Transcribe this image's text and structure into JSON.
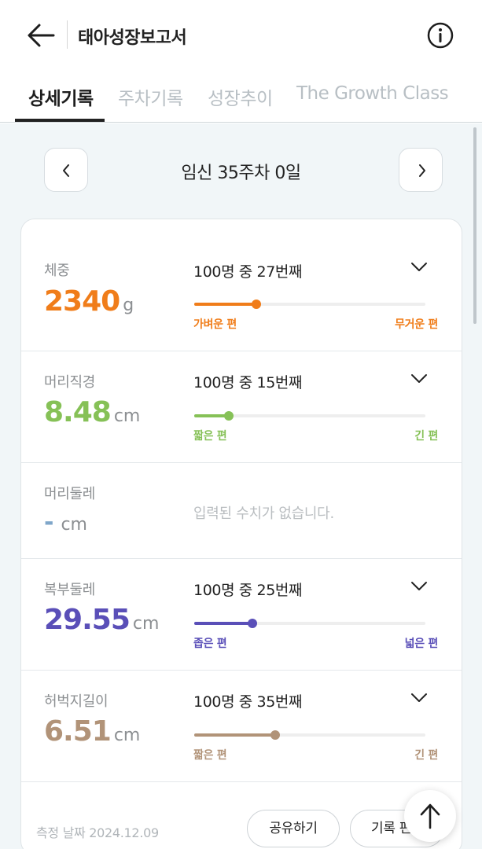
{
  "header": {
    "title": "태아성장보고서",
    "back_icon": "arrow-left-icon",
    "info_icon": "info-circle-icon"
  },
  "tabs": [
    {
      "label": "상세기록",
      "active": true
    },
    {
      "label": "주차기록",
      "active": false
    },
    {
      "label": "성장추이",
      "active": false
    },
    {
      "label": "The Growth Class",
      "active": false
    }
  ],
  "week_nav": {
    "label": "임신 35주차 0일",
    "prev_icon": "chevron-left-icon",
    "next_icon": "chevron-right-icon"
  },
  "measurements": [
    {
      "label": "체중",
      "value": "2340",
      "unit": "g",
      "rank_text": "100명 중 27번째",
      "percentile": 0.27,
      "low_label": "가벼운 편",
      "high_label": "무거운 편",
      "color": "#f07d1a"
    },
    {
      "label": "머리직경",
      "value": "8.48",
      "unit": "cm",
      "rank_text": "100명 중 15번째",
      "percentile": 0.15,
      "low_label": "짧은 편",
      "high_label": "긴 편",
      "color": "#86c157"
    },
    {
      "label": "머리둘레",
      "value": "-",
      "unit": "cm",
      "no_data_text": "입력된 수치가 없습니다.",
      "color": "#7fa6c9"
    },
    {
      "label": "복부둘레",
      "value": "29.55",
      "unit": "cm",
      "rank_text": "100명 중 25번째",
      "percentile": 0.25,
      "low_label": "좁은 편",
      "high_label": "넓은 편",
      "color": "#5a4fb8"
    },
    {
      "label": "허벅지길이",
      "value": "6.51",
      "unit": "cm",
      "rank_text": "100명 중 35번째",
      "percentile": 0.35,
      "low_label": "짧은 편",
      "high_label": "긴 편",
      "color": "#b19378"
    }
  ],
  "footer": {
    "measure_date": "측정 날짜 2024.12.09",
    "share_label": "공유하기",
    "record_label": "기록 편집"
  },
  "fab": {
    "icon": "arrow-up-icon"
  }
}
